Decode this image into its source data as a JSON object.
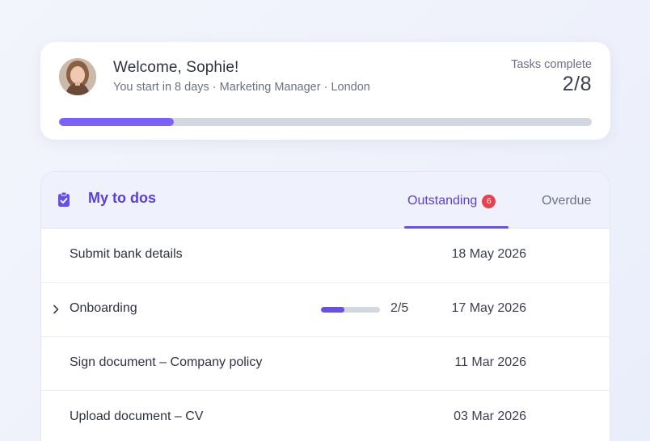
{
  "welcome": {
    "title": "Welcome, Sophie!",
    "subtitle": "You start in 8 days · Marketing Manager · London",
    "tasks_label": "Tasks complete",
    "tasks_count": "2/8",
    "progress_fraction": 0.215,
    "avatar_icon": "user-avatar-photo"
  },
  "todos": {
    "title": "My to dos",
    "title_icon": "clipboard-check-icon",
    "tabs": [
      {
        "label": "Outstanding",
        "badge": "6",
        "active": true
      },
      {
        "label": "Overdue",
        "active": false
      }
    ],
    "rows": [
      {
        "label": "Submit bank details",
        "date": "18 May 2026"
      },
      {
        "label": "Onboarding",
        "date": "17 May 2026",
        "expandable": true,
        "progress_text": "2/5",
        "progress_fraction": 0.4
      },
      {
        "label": "Sign document – Company policy",
        "date": "11 Mar 2026"
      },
      {
        "label": "Upload document – CV",
        "date": "03 Mar 2026"
      }
    ]
  },
  "colors": {
    "accent": "#5b3fd6",
    "progress": "#7b61f6",
    "badge": "#e8424f",
    "track": "#d3d7e0"
  }
}
